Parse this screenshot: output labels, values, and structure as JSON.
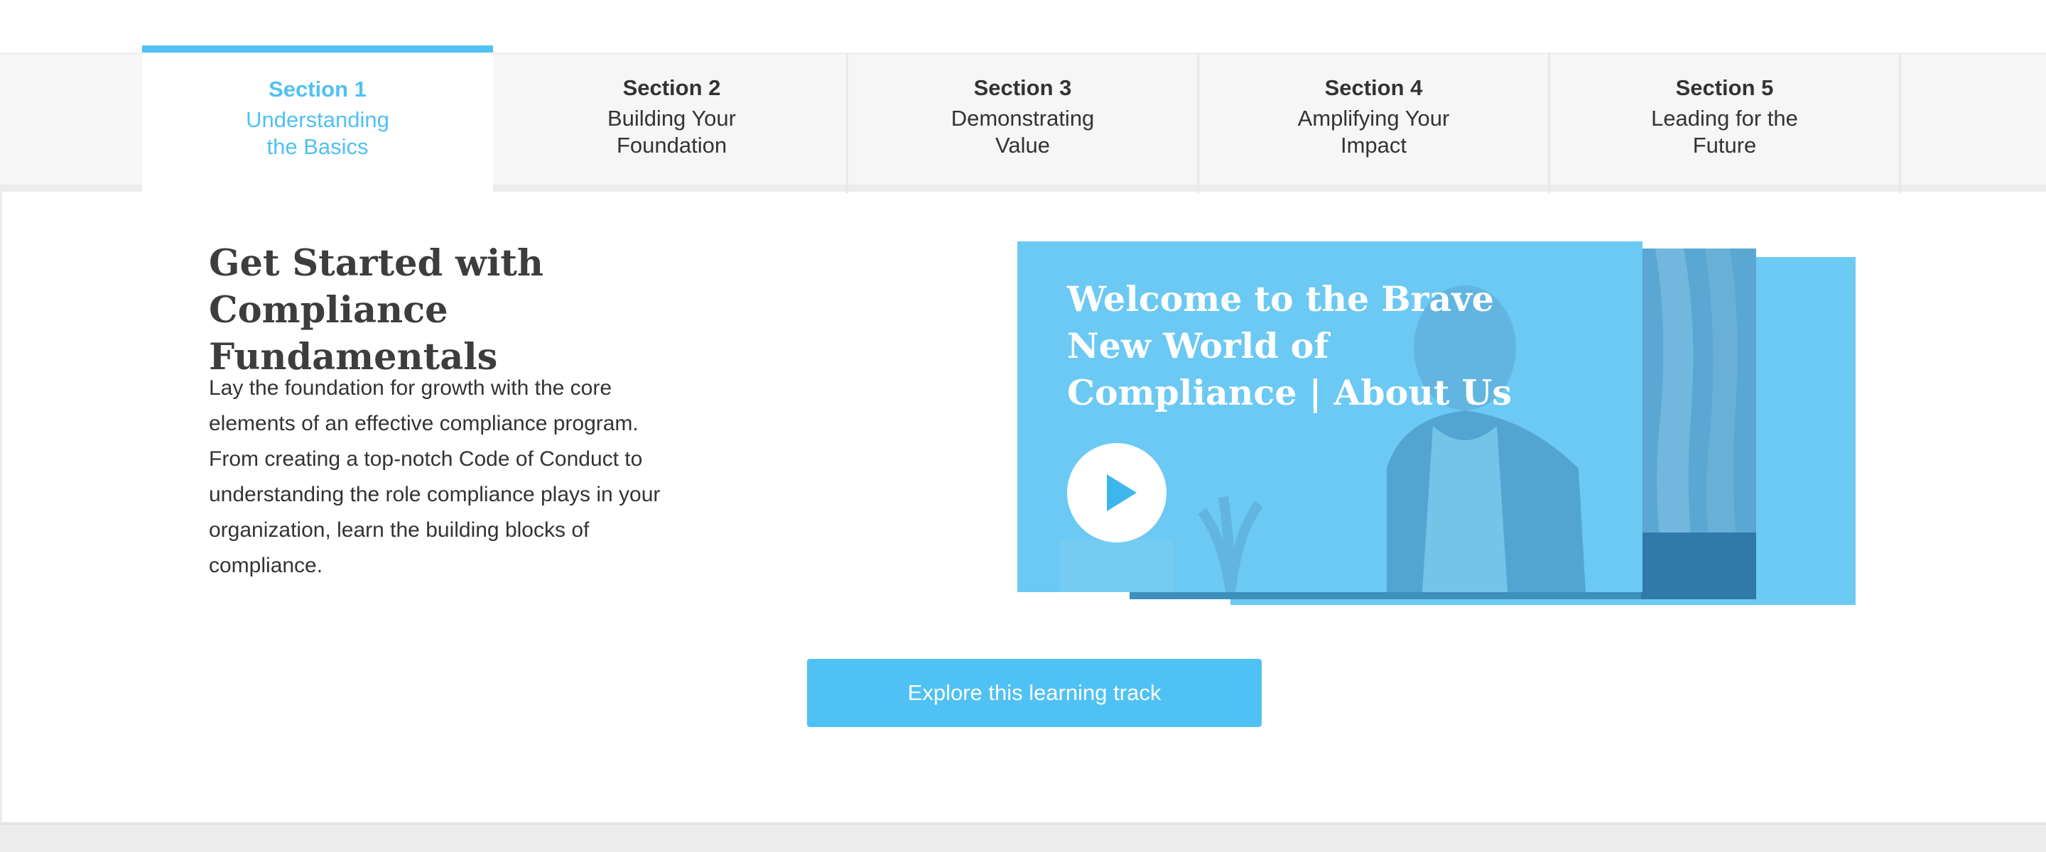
{
  "tabs": [
    {
      "title": "Section 1",
      "line1": "Understanding",
      "line2": "the Basics",
      "active": true
    },
    {
      "title": "Section 2",
      "line1": "Building Your",
      "line2": "Foundation",
      "active": false
    },
    {
      "title": "Section 3",
      "line1": "Demonstrating",
      "line2": "Value",
      "active": false
    },
    {
      "title": "Section 4",
      "line1": "Amplifying Your",
      "line2": "Impact",
      "active": false
    },
    {
      "title": "Section 5",
      "line1": "Leading for the",
      "line2": "Future",
      "active": false
    }
  ],
  "main": {
    "heading_line1": "Get Started with",
    "heading_line2": "Compliance Fundamentals",
    "description": "Lay the foundation for growth with the core elements of an effective compliance program. From creating a top-notch Code of Conduct to understanding the role compliance plays in your organization, learn the building blocks of compliance."
  },
  "video": {
    "title_line1": "Welcome to the Brave",
    "title_line2": "New World of",
    "title_line3": "Compliance | About Us",
    "play_icon": "play-icon"
  },
  "cta": {
    "label": "Explore this learning track"
  },
  "colors": {
    "accent": "#4fc1f4",
    "tab_bg": "#f6f6f6",
    "card": "#6bc9f3",
    "card_shadow": "#3f8fbd"
  }
}
